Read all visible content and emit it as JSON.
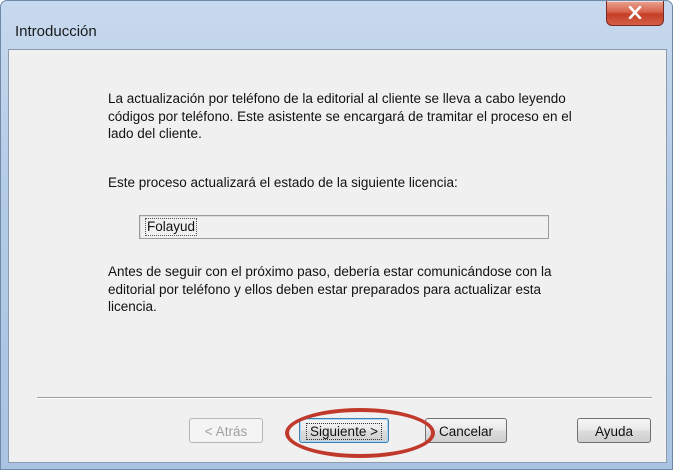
{
  "window": {
    "title": "Introducción",
    "close_label": "✕"
  },
  "content": {
    "intro_text": "La actualización por teléfono de la editorial al cliente se lleva a cabo leyendo códigos por teléfono. Este asistente se encargará de tramitar el proceso en el lado del cliente.",
    "license_prompt": "Este proceso actualizará el estado de la siguiente licencia:",
    "license_name": "Folayud",
    "warning_text": "Antes de seguir con el próximo paso, debería estar comunicándose con la editorial por teléfono y ellos deben estar preparados para actualizar esta licencia."
  },
  "buttons": {
    "back": "< Atrás",
    "next": "Siguiente >",
    "cancel": "Cancelar",
    "help": "Ayuda"
  },
  "colors": {
    "annotation": "#c0392b",
    "close_button": "#c94a31"
  }
}
